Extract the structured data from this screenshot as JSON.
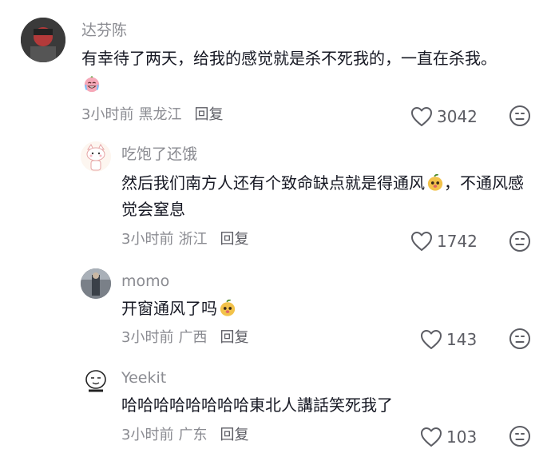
{
  "comments": [
    {
      "username": "达芬陈",
      "text": "有幸待了两天，给我的感觉就是杀不死我的，一直在杀我。",
      "emoji": "crying-laughing-emoji",
      "time": "3小时前",
      "location": "黑龙江",
      "reply_label": "回复",
      "likes": "3042"
    },
    {
      "username": "吃饱了还饿",
      "text": "然后我们南方人还有个致命缺点就是得通风",
      "emoji": "mango-face-emoji",
      "text_after": "，不通风感觉会窒息",
      "time": "3小时前",
      "location": "浙江",
      "reply_label": "回复",
      "likes": "1742"
    },
    {
      "username": "momo",
      "text": "开窗通风了吗",
      "emoji": "mango-face-emoji",
      "time": "3小时前",
      "location": "广西",
      "reply_label": "回复",
      "likes": "143"
    },
    {
      "username": "Yeekit",
      "text": "哈哈哈哈哈哈哈哈東北人講話笑死我了",
      "time": "3小时前",
      "location": "广东",
      "reply_label": "回复",
      "likes": "103"
    }
  ],
  "colors": {
    "username": "#8a8b91",
    "text": "#161823",
    "meta": "#8a8b91",
    "icon": "#5c5d64"
  }
}
